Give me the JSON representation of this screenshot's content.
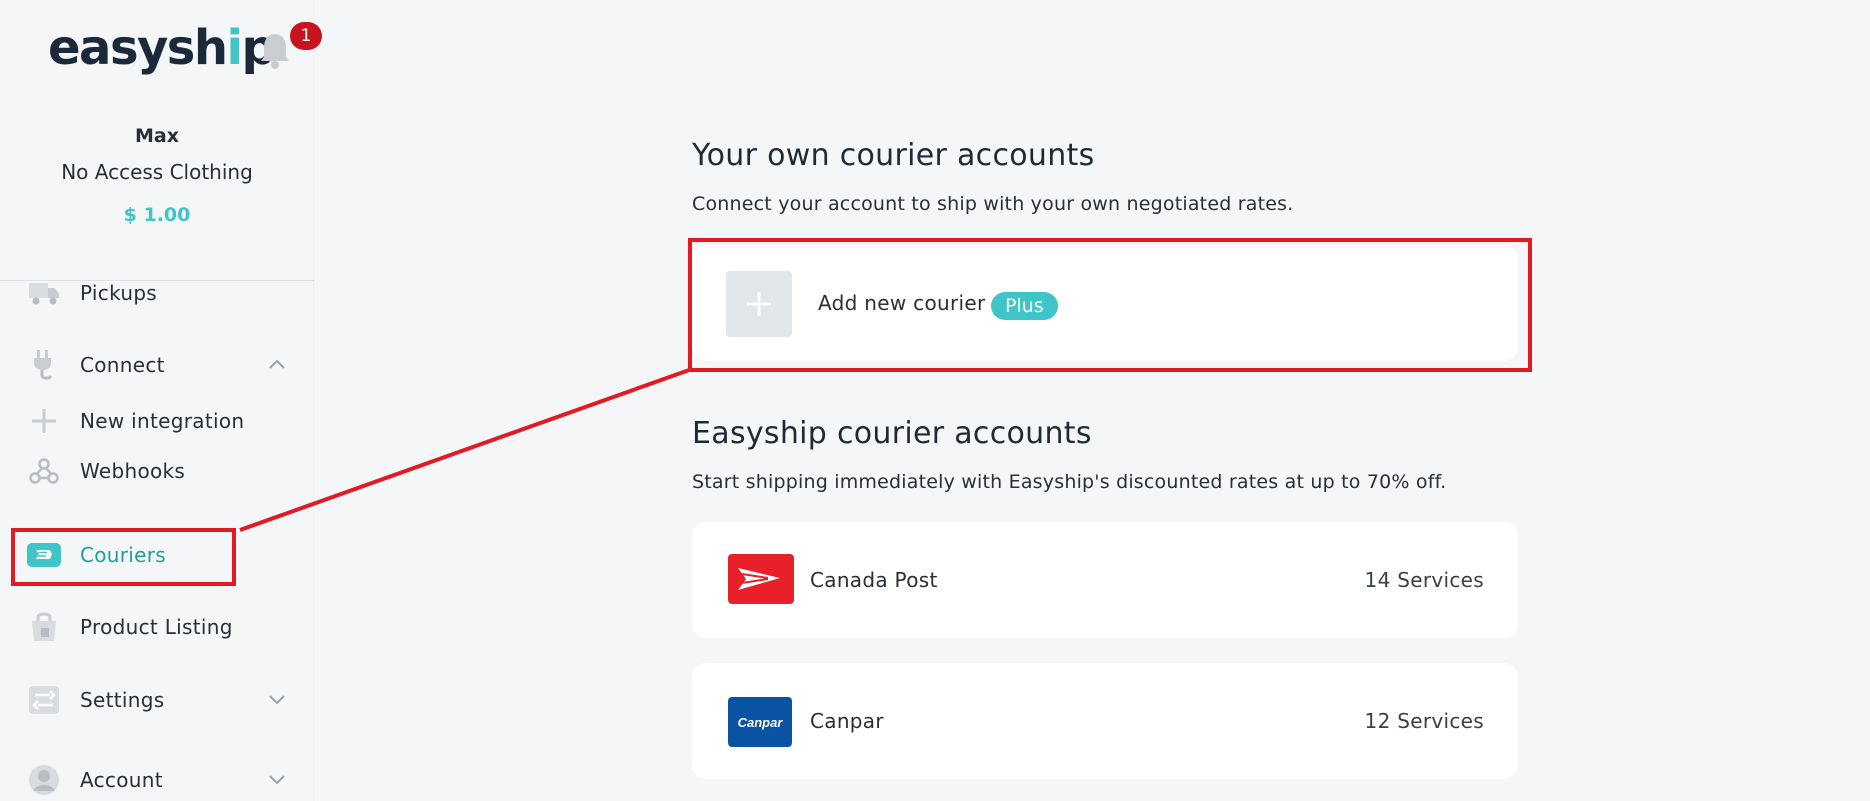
{
  "brand": {
    "logo_text_left": "easysh",
    "logo_text_right": "p",
    "logo_i": "i"
  },
  "notifications": {
    "count": "1"
  },
  "profile": {
    "name": "Max",
    "company": "No Access Clothing",
    "balance": "$ 1.00"
  },
  "sidebar": {
    "items": [
      {
        "label": "Pickups",
        "icon": "truck-icon"
      },
      {
        "label": "Connect",
        "icon": "plug-icon",
        "expanded": true
      },
      {
        "label": "New integration",
        "icon": "plus-icon"
      },
      {
        "label": "Webhooks",
        "icon": "webhook-icon"
      },
      {
        "label": "Couriers",
        "icon": "courier-icon",
        "active": true
      },
      {
        "label": "Product Listing",
        "icon": "shopping-bag-icon"
      },
      {
        "label": "Settings",
        "icon": "settings-icon",
        "expanded": false
      },
      {
        "label": "Account",
        "icon": "user-icon",
        "expanded": false
      }
    ]
  },
  "own_accounts": {
    "title": "Your own courier accounts",
    "subtitle": "Connect your account to ship with your own negotiated rates.",
    "add_label": "Add new courier",
    "plan_badge": "Plus"
  },
  "easyship_accounts": {
    "title": "Easyship courier accounts",
    "subtitle": "Start shipping immediately with Easyship's discounted rates at up to 70% off.",
    "couriers": [
      {
        "name": "Canada Post",
        "services": "14 Services",
        "logo_color": "#e8202a"
      },
      {
        "name": "Canpar",
        "services": "12 Services",
        "logo_color": "#0a52a4",
        "logo_text": "Canpar"
      }
    ]
  },
  "colors": {
    "accent": "#3fc4c8",
    "active_text": "#229c9c",
    "highlight": "#e01b24",
    "badge": "#c8141f"
  }
}
